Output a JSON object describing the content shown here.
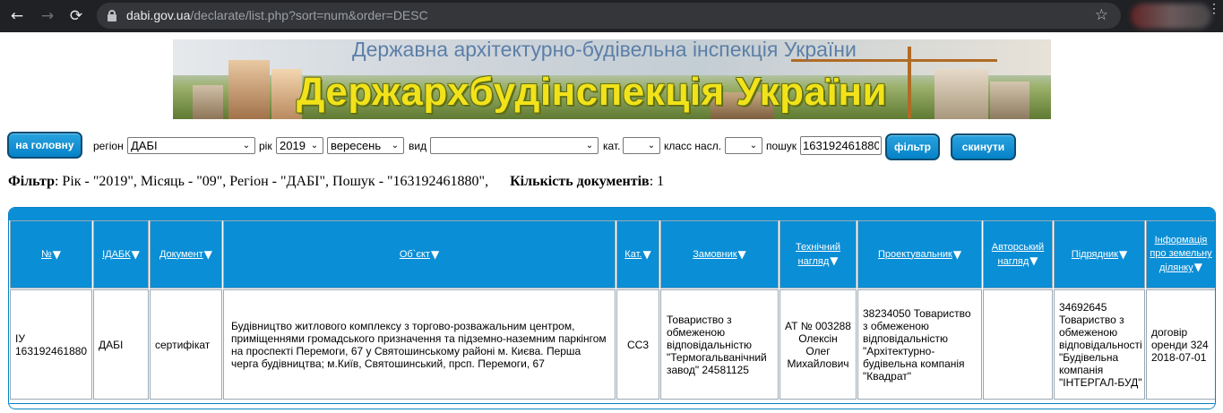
{
  "browser": {
    "url_host": "dabi.gov.ua",
    "url_path": "/declarate/list.php?sort=num&order=DESC",
    "back_glyph": "←",
    "forward_glyph": "→",
    "reload_glyph": "⟳",
    "star_glyph": "☆",
    "menu_glyph": "⋮"
  },
  "banner": {
    "subtitle": "Державна архітектурно-будівельна інспекція України",
    "title": "Держархбудінспекція України"
  },
  "filters": {
    "home_button": "на головну",
    "region_label": "регіон",
    "region_value": "ДАБІ",
    "year_label": "рік",
    "year_value": "2019",
    "month_value": "вересень",
    "type_label": "вид",
    "type_value": "",
    "category_label": "кат.",
    "category_value": "",
    "class_label": "класс насл.",
    "class_value": "",
    "search_label": "пошук",
    "search_value": "163192461880",
    "filter_button": "фільтр",
    "reset_button": "скинути",
    "dropdown_glyph": "⌄"
  },
  "summary": {
    "filter_label": "Фільтр",
    "filter_text": ": Рік - \"2019\", Місяць - \"09\", Регіон - \"ДАБІ\", Пошук - \"163192461880\",",
    "count_label": "Кількість документів",
    "count_text": ": 1"
  },
  "table": {
    "sort_glyph": "▼",
    "headers": [
      "№",
      "ІДАБК",
      "Документ",
      "Об`єкт",
      "Кат.",
      "Замовник",
      "Технічний нагляд",
      "Проектувальник",
      "Авторський нагляд",
      "Підрядник",
      "Інформація про земельну ділянку"
    ],
    "rows": [
      {
        "num": "ІУ 163192461880",
        "idabk": "ДАБІ",
        "document": "сертифікат",
        "object": "Будівництво житлового комплексу з торгово-розважальним центром, приміщеннями громадського призначення та підземно-наземним паркінгом на проспекті Перемоги, 67 у Святошинському районі м. Києва. Перша черга будівництва; м.Київ, Святошинський, прсп. Перемоги, 67",
        "category": "СС3",
        "customer": "Товариство з обмеженою відповідальністю \"Термогальванічний завод\" 24581125",
        "tech_supervision": "АТ № 003288 Олексін Олег Михайлович",
        "designer": "38234050 Товариство з обмеженою відповідальністю \"Архітектурно-будівельна компанія \"Квадрат\"",
        "author_supervision": "",
        "contractor": "34692645 Товариство з обмеженою відповідальності \"Будівельна компанія \"ІНТЕРГАЛ-БУД\"",
        "land_info": "договір оренди 324 2018-07-01"
      }
    ]
  }
}
